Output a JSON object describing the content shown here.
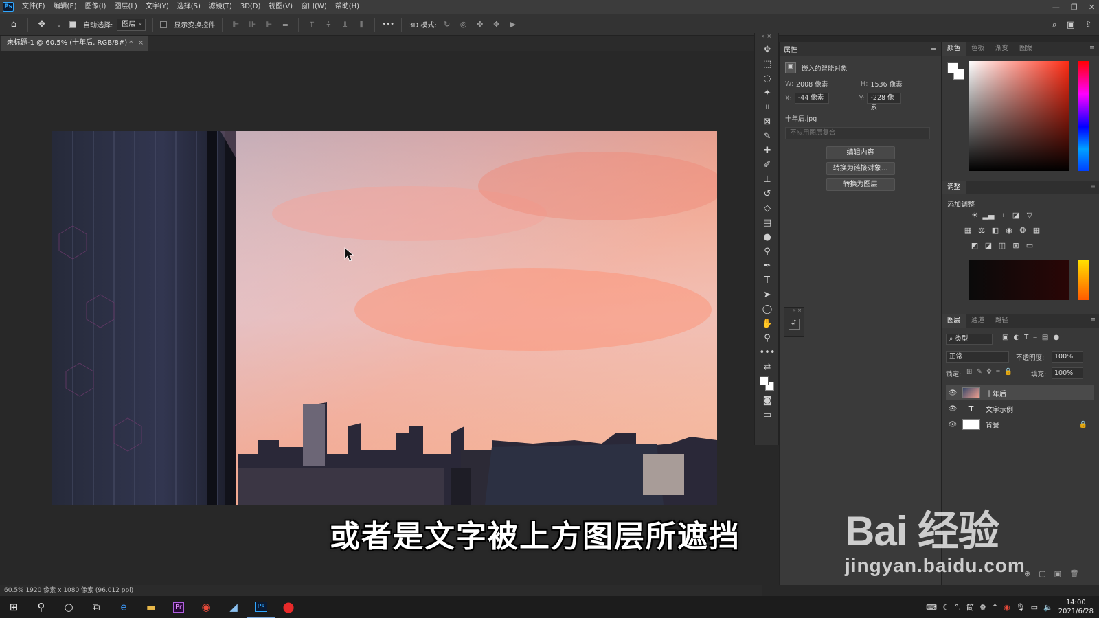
{
  "menubar": {
    "app_logo": "Ps",
    "items": [
      "文件(F)",
      "编辑(E)",
      "图像(I)",
      "图层(L)",
      "文字(Y)",
      "选择(S)",
      "滤镜(T)",
      "3D(D)",
      "视图(V)",
      "窗口(W)",
      "帮助(H)"
    ]
  },
  "optionsbar": {
    "auto_select_label": "自动选择:",
    "auto_select_target": "图层",
    "show_transform_label": "显示变换控件",
    "mode_3d_label": "3D 模式:",
    "more_label": "•••"
  },
  "document": {
    "tab_title": "未标题-1 @ 60.5% (十年后, RGB/8#) *"
  },
  "status": {
    "text": "60.5%   1920 像素 x 1080 像素 (96.012 ppi)"
  },
  "caption": "或者是文字被上方图层所遮挡",
  "properties": {
    "tab": "属性",
    "type_label": "嵌入的智能对象",
    "w_label": "W:",
    "w_value": "2008 像素",
    "h_label": "H:",
    "h_value": "1536 像素",
    "x_label": "X:",
    "x_value": "-44 像素",
    "y_label": "Y:",
    "y_value": "-228 像素",
    "filename": "十年后.jpg",
    "comp_placeholder": "不应用图层复合",
    "buttons": [
      "编辑内容",
      "转换为链接对象...",
      "转换为图层"
    ]
  },
  "color_panel": {
    "tabs": [
      "颜色",
      "色板",
      "渐变",
      "图案"
    ]
  },
  "adjust_panel": {
    "tab": "调整",
    "add_label": "添加调整"
  },
  "layers_panel": {
    "tabs": [
      "图层",
      "通道",
      "路径"
    ],
    "filter_kind": "类型",
    "blend_mode": "正常",
    "opacity_label": "不透明度:",
    "opacity_value": "100%",
    "lock_label": "锁定:",
    "fill_label": "填充:",
    "fill_value": "100%",
    "layers": [
      {
        "name": "十年后",
        "kind": "smart"
      },
      {
        "name": "文字示例",
        "kind": "text"
      },
      {
        "name": "背景",
        "kind": "background"
      }
    ]
  },
  "watermark": {
    "brand": "Bai 经验",
    "url": "jingyan.baidu.com"
  },
  "taskbar": {
    "time": "14:00",
    "date": "2021/6/28",
    "ime": "简"
  }
}
